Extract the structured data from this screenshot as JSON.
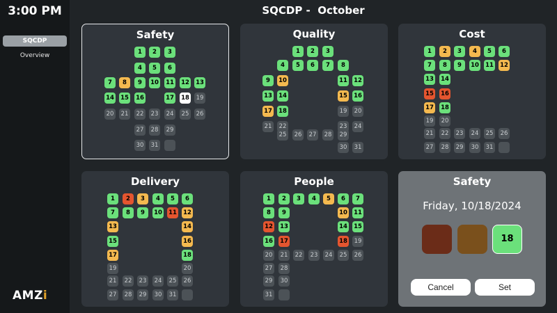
{
  "clock": "3:00 PM",
  "header_title": "SQCDP -  October",
  "nav": [
    {
      "label": "SQCDP",
      "active": true
    },
    {
      "label": "Overview",
      "active": false
    }
  ],
  "logo": {
    "main": "AMZ",
    "accent": "i"
  },
  "status_colors": {
    "green": "#6be07b",
    "yellow": "#f4b94f",
    "red": "#e4552f",
    "selected": "#ffffff",
    "none": "#4c5257"
  },
  "panels": [
    {
      "title": "Safety",
      "letter": "S",
      "selected": true,
      "days": {
        "1": "g",
        "2": "g",
        "3": "g",
        "4": "g",
        "5": "g",
        "6": "g",
        "7": "g",
        "8": "y",
        "9": "g",
        "10": "g",
        "11": "g",
        "12": "g",
        "13": "g",
        "14": "g",
        "15": "g",
        "16": "g",
        "17": "g",
        "18": "w",
        "19": "n",
        "20": "n",
        "21": "n",
        "22": "n",
        "23": "n",
        "24": "n",
        "25": "n",
        "26": "n",
        "27": "n",
        "28": "n",
        "29": "n",
        "30": "n",
        "31": "n",
        "32": "e"
      }
    },
    {
      "title": "Quality",
      "letter": "Q",
      "selected": false,
      "days": {
        "1": "g",
        "2": "g",
        "3": "g",
        "4": "g",
        "5": "g",
        "6": "g",
        "7": "g",
        "8": "g",
        "9": "g",
        "10": "y",
        "11": "g",
        "12": "g",
        "13": "g",
        "14": "g",
        "15": "y",
        "16": "g",
        "17": "y",
        "18": "g",
        "19": "n",
        "20": "n",
        "21": "n",
        "22": "n",
        "23": "n",
        "24": "n",
        "25": "n",
        "26": "n",
        "27": "n",
        "28": "n",
        "29": "n",
        "30": "n",
        "31": "n"
      }
    },
    {
      "title": "Cost",
      "letter": "C",
      "selected": false,
      "days": {
        "1": "g",
        "2": "y",
        "3": "g",
        "4": "y",
        "5": "g",
        "6": "g",
        "7": "g",
        "8": "g",
        "9": "g",
        "10": "g",
        "11": "g",
        "12": "y",
        "13": "g",
        "14": "g",
        "15": "r",
        "16": "r",
        "17": "y",
        "18": "g",
        "19": "n",
        "20": "n",
        "21": "n",
        "22": "n",
        "23": "n",
        "24": "n",
        "25": "n",
        "26": "n",
        "27": "n",
        "28": "n",
        "29": "n",
        "30": "n",
        "31": "n",
        "32": "e"
      }
    },
    {
      "title": "Delivery",
      "letter": "D",
      "selected": false,
      "days": {
        "1": "g",
        "2": "r",
        "3": "y",
        "4": "g",
        "5": "g",
        "6": "g",
        "7": "g",
        "8": "g",
        "9": "g",
        "10": "g",
        "11": "r",
        "12": "y",
        "13": "y",
        "14": "y",
        "15": "g",
        "16": "y",
        "17": "y",
        "18": "g",
        "19": "n",
        "20": "n",
        "21": "n",
        "22": "n",
        "23": "n",
        "24": "n",
        "25": "n",
        "26": "n",
        "27": "n",
        "28": "n",
        "29": "n",
        "30": "n",
        "31": "n",
        "32": "e"
      }
    },
    {
      "title": "People",
      "letter": "P",
      "selected": false,
      "days": {
        "1": "g",
        "2": "g",
        "3": "g",
        "4": "g",
        "5": "y",
        "6": "g",
        "7": "g",
        "8": "g",
        "9": "g",
        "10": "y",
        "11": "g",
        "12": "r",
        "13": "g",
        "14": "g",
        "15": "g",
        "16": "g",
        "17": "r",
        "18": "r",
        "19": "n",
        "20": "n",
        "21": "n",
        "22": "n",
        "23": "n",
        "24": "n",
        "25": "n",
        "26": "n",
        "27": "n",
        "28": "n",
        "29": "n",
        "30": "n",
        "31": "n",
        "32": "e"
      }
    }
  ],
  "detail": {
    "title": "Safety",
    "date": "Friday, 10/18/2024",
    "selected_day": "18",
    "cancel_label": "Cancel",
    "set_label": "Set"
  }
}
